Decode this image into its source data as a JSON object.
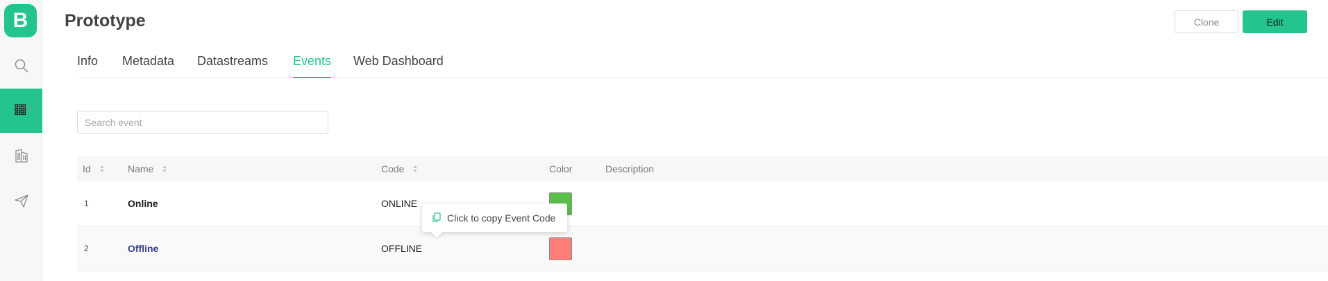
{
  "app": {
    "logo_letter": "B",
    "accent": "#23c48e"
  },
  "sidebar": {
    "items": [
      {
        "name": "search",
        "icon": "search-icon",
        "active": false
      },
      {
        "name": "products",
        "icon": "grid-icon",
        "active": true
      },
      {
        "name": "organizations",
        "icon": "building-icon",
        "active": false
      },
      {
        "name": "messages",
        "icon": "paper-plane-icon",
        "active": false
      }
    ]
  },
  "header": {
    "title": "Prototype",
    "clone_label": "Clone",
    "edit_label": "Edit"
  },
  "tabs": [
    {
      "label": "Info",
      "active": false
    },
    {
      "label": "Metadata",
      "active": false
    },
    {
      "label": "Datastreams",
      "active": false
    },
    {
      "label": "Events",
      "active": true
    },
    {
      "label": "Web Dashboard",
      "active": false
    }
  ],
  "search": {
    "placeholder": "Search event",
    "value": ""
  },
  "table": {
    "columns": [
      "Id",
      "Name",
      "Code",
      "Color",
      "Description"
    ],
    "rows": [
      {
        "id": "1",
        "name": "Online",
        "code": "ONLINE",
        "color": "#5cbf4a",
        "description": ""
      },
      {
        "id": "2",
        "name": "Offline",
        "code": "OFFLINE",
        "color": "#ff7f78",
        "description": ""
      }
    ]
  },
  "tooltip": {
    "text": "Click to copy Event Code",
    "icon": "copy-icon"
  }
}
